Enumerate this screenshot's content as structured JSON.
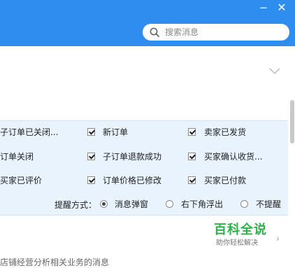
{
  "window": {
    "minimize_glyph": "−",
    "close_glyph": "✕",
    "accent_color": "#2f8df0"
  },
  "search": {
    "placeholder": "搜索消息",
    "icon": "search-icon"
  },
  "collapse": {
    "icon": "chevron-down-icon"
  },
  "notifications": {
    "options": [
      {
        "label": "子订单已关闭...",
        "checked": true
      },
      {
        "label": "新订单",
        "checked": true
      },
      {
        "label": "卖家已发货",
        "checked": true
      },
      {
        "label": "订单关闭",
        "checked": true
      },
      {
        "label": "子订单退款成功",
        "checked": true
      },
      {
        "label": "买家确认收货...",
        "checked": true
      },
      {
        "label": "买家已评价",
        "checked": true
      },
      {
        "label": "订单价格已修改",
        "checked": true
      },
      {
        "label": "买家已付款",
        "checked": false
      }
    ],
    "mode": {
      "label": "提醒方式：",
      "choices": [
        "消息弹窗",
        "右下角浮出",
        "不提醒"
      ],
      "selected": "消息弹窗"
    }
  },
  "footer": {
    "text": "店铺经营分析相关业务的消息"
  },
  "watermark": {
    "logo": "百科全说",
    "subtitle": "助你轻松解决",
    "arrow": "›"
  }
}
